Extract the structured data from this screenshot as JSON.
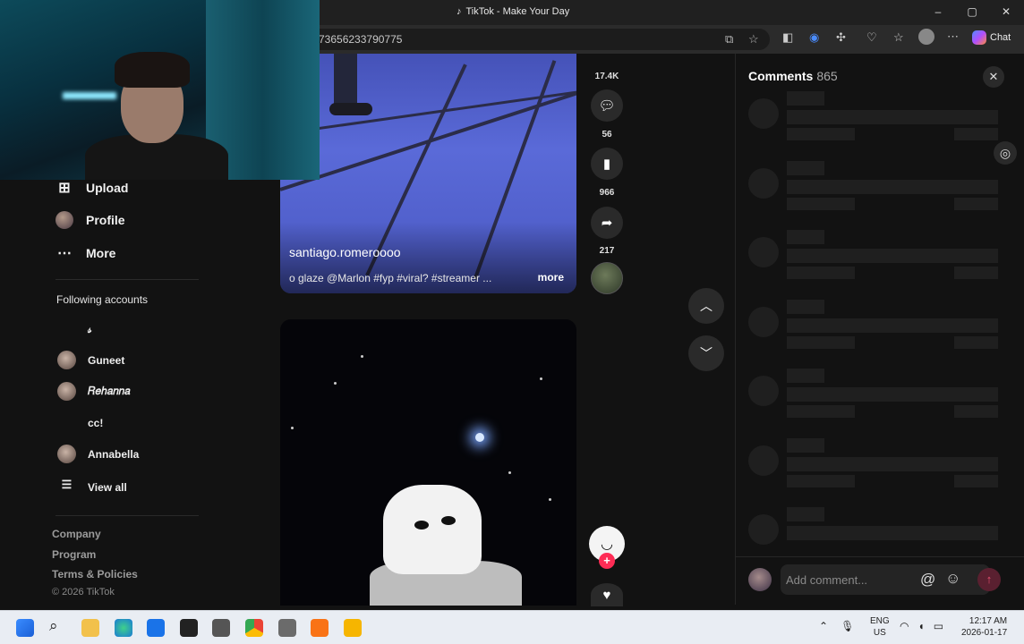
{
  "window": {
    "title": "TikTok - Make Your Day",
    "minimize": "–",
    "maximize": "▢",
    "close": "✕"
  },
  "address_bar": {
    "url": "73656233790775",
    "chat_label": "Chat"
  },
  "sidebar": {
    "nav": [
      {
        "icon": "plus-square-icon",
        "label": "Upload"
      },
      {
        "icon": "avatar",
        "label": "Profile"
      },
      {
        "icon": "more-dots-icon",
        "label": "More"
      }
    ],
    "following_title": "Following accounts",
    "accounts": [
      {
        "name": "𝓈"
      },
      {
        "name": "Guneet"
      },
      {
        "name": "𝑅𝑒ℎ𝑎𝑛𝑛𝑎"
      },
      {
        "name": "cc!"
      },
      {
        "name": "Annabella"
      }
    ],
    "view_all": "View all",
    "footer": [
      "Company",
      "Program",
      "Terms & Policies"
    ],
    "copyright": "© 2026 TikTok"
  },
  "video1": {
    "author": "santiago.romeroooo",
    "caption": "o glaze @Marlon #fyp #viral? #streamer ...",
    "more": "more"
  },
  "actions": {
    "likes": "17.4K",
    "comments": "56",
    "saves": "966",
    "shares": "217"
  },
  "comments_panel": {
    "title": "Comments",
    "count": "865",
    "input_placeholder": "Add comment...",
    "skeleton_rows": 7
  },
  "taskbar": {
    "lang_line1": "ENG",
    "lang_line2": "US",
    "time": "12:17 AM",
    "date": "2026-01-17"
  },
  "colors": {
    "accent": "#fe2c55",
    "background": "#121212"
  }
}
